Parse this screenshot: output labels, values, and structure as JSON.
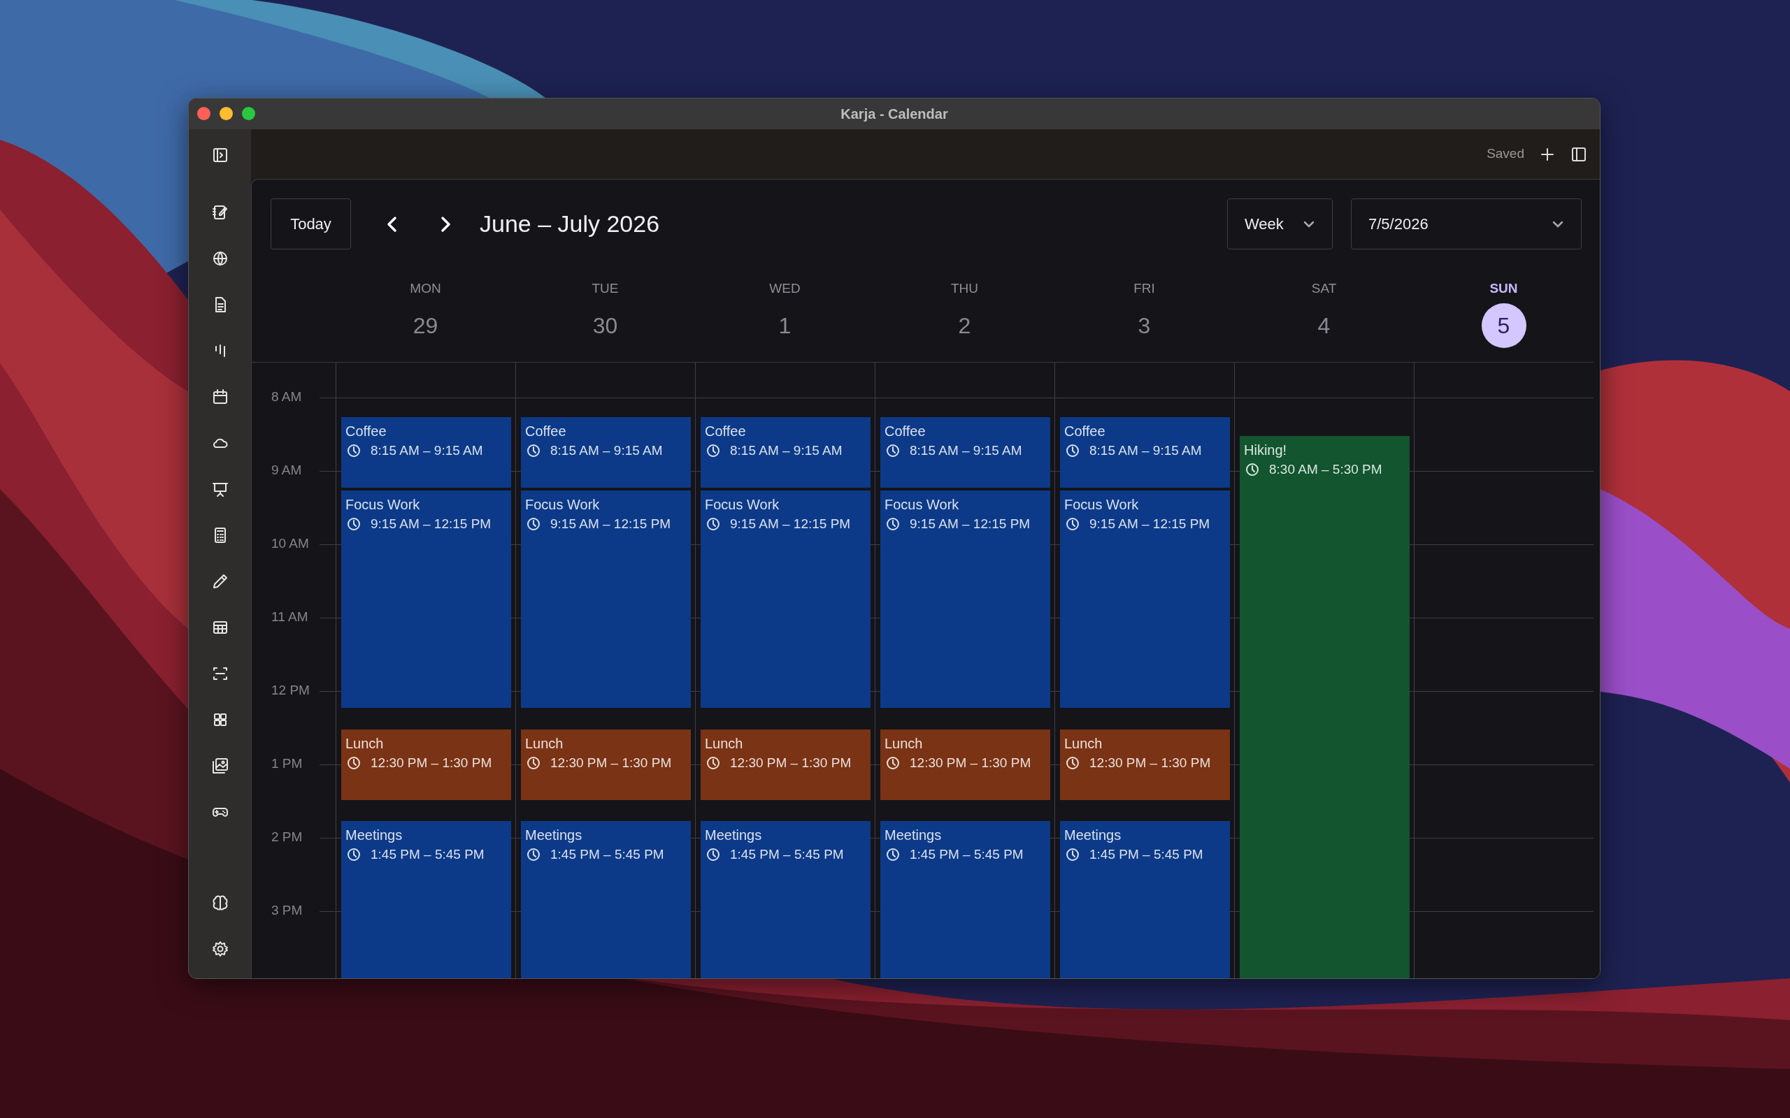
{
  "window": {
    "title": "Karja - Calendar"
  },
  "toolbar": {
    "status": "Saved"
  },
  "calendar": {
    "today_button": "Today",
    "title": "June – July 2026",
    "view_select": "Week",
    "date_select": "7/5/2026",
    "hours": [
      "8 AM",
      "9 AM",
      "10 AM",
      "11 AM",
      "12 PM",
      "1 PM",
      "2 PM",
      "3 PM"
    ],
    "days": [
      {
        "name": "MON",
        "number": "29",
        "selected": false,
        "events": [
          {
            "title": "Coffee",
            "time": "8:15 AM – 9:15 AM",
            "color": "#0c3a88"
          },
          {
            "title": "Focus Work",
            "time": "9:15 AM – 12:15 PM",
            "color": "#0c3a88"
          },
          {
            "title": "Lunch",
            "time": "12:30 PM – 1:30 PM",
            "color": "#7a3314"
          },
          {
            "title": "Meetings",
            "time": "1:45 PM – 5:45 PM",
            "color": "#0c3a88"
          }
        ]
      },
      {
        "name": "TUE",
        "number": "30",
        "selected": false,
        "events": [
          {
            "title": "Coffee",
            "time": "8:15 AM – 9:15 AM",
            "color": "#0c3a88"
          },
          {
            "title": "Focus Work",
            "time": "9:15 AM – 12:15 PM",
            "color": "#0c3a88"
          },
          {
            "title": "Lunch",
            "time": "12:30 PM – 1:30 PM",
            "color": "#7a3314"
          },
          {
            "title": "Meetings",
            "time": "1:45 PM – 5:45 PM",
            "color": "#0c3a88"
          }
        ]
      },
      {
        "name": "WED",
        "number": "1",
        "selected": false,
        "events": [
          {
            "title": "Coffee",
            "time": "8:15 AM – 9:15 AM",
            "color": "#0c3a88"
          },
          {
            "title": "Focus Work",
            "time": "9:15 AM – 12:15 PM",
            "color": "#0c3a88"
          },
          {
            "title": "Lunch",
            "time": "12:30 PM – 1:30 PM",
            "color": "#7a3314"
          },
          {
            "title": "Meetings",
            "time": "1:45 PM – 5:45 PM",
            "color": "#0c3a88"
          }
        ]
      },
      {
        "name": "THU",
        "number": "2",
        "selected": false,
        "events": [
          {
            "title": "Coffee",
            "time": "8:15 AM – 9:15 AM",
            "color": "#0c3a88"
          },
          {
            "title": "Focus Work",
            "time": "9:15 AM – 12:15 PM",
            "color": "#0c3a88"
          },
          {
            "title": "Lunch",
            "time": "12:30 PM – 1:30 PM",
            "color": "#7a3314"
          },
          {
            "title": "Meetings",
            "time": "1:45 PM – 5:45 PM",
            "color": "#0c3a88"
          }
        ]
      },
      {
        "name": "FRI",
        "number": "3",
        "selected": false,
        "events": [
          {
            "title": "Coffee",
            "time": "8:15 AM – 9:15 AM",
            "color": "#0c3a88"
          },
          {
            "title": "Focus Work",
            "time": "9:15 AM – 12:15 PM",
            "color": "#0c3a88"
          },
          {
            "title": "Lunch",
            "time": "12:30 PM – 1:30 PM",
            "color": "#7a3314"
          },
          {
            "title": "Meetings",
            "time": "1:45 PM – 5:45 PM",
            "color": "#0c3a88"
          }
        ]
      },
      {
        "name": "SAT",
        "number": "4",
        "selected": false,
        "events": [
          {
            "title": "Hiking!",
            "time": "8:30 AM – 5:30 PM",
            "color": "#12552f"
          }
        ]
      },
      {
        "name": "SUN",
        "number": "5",
        "selected": true
      }
    ]
  }
}
